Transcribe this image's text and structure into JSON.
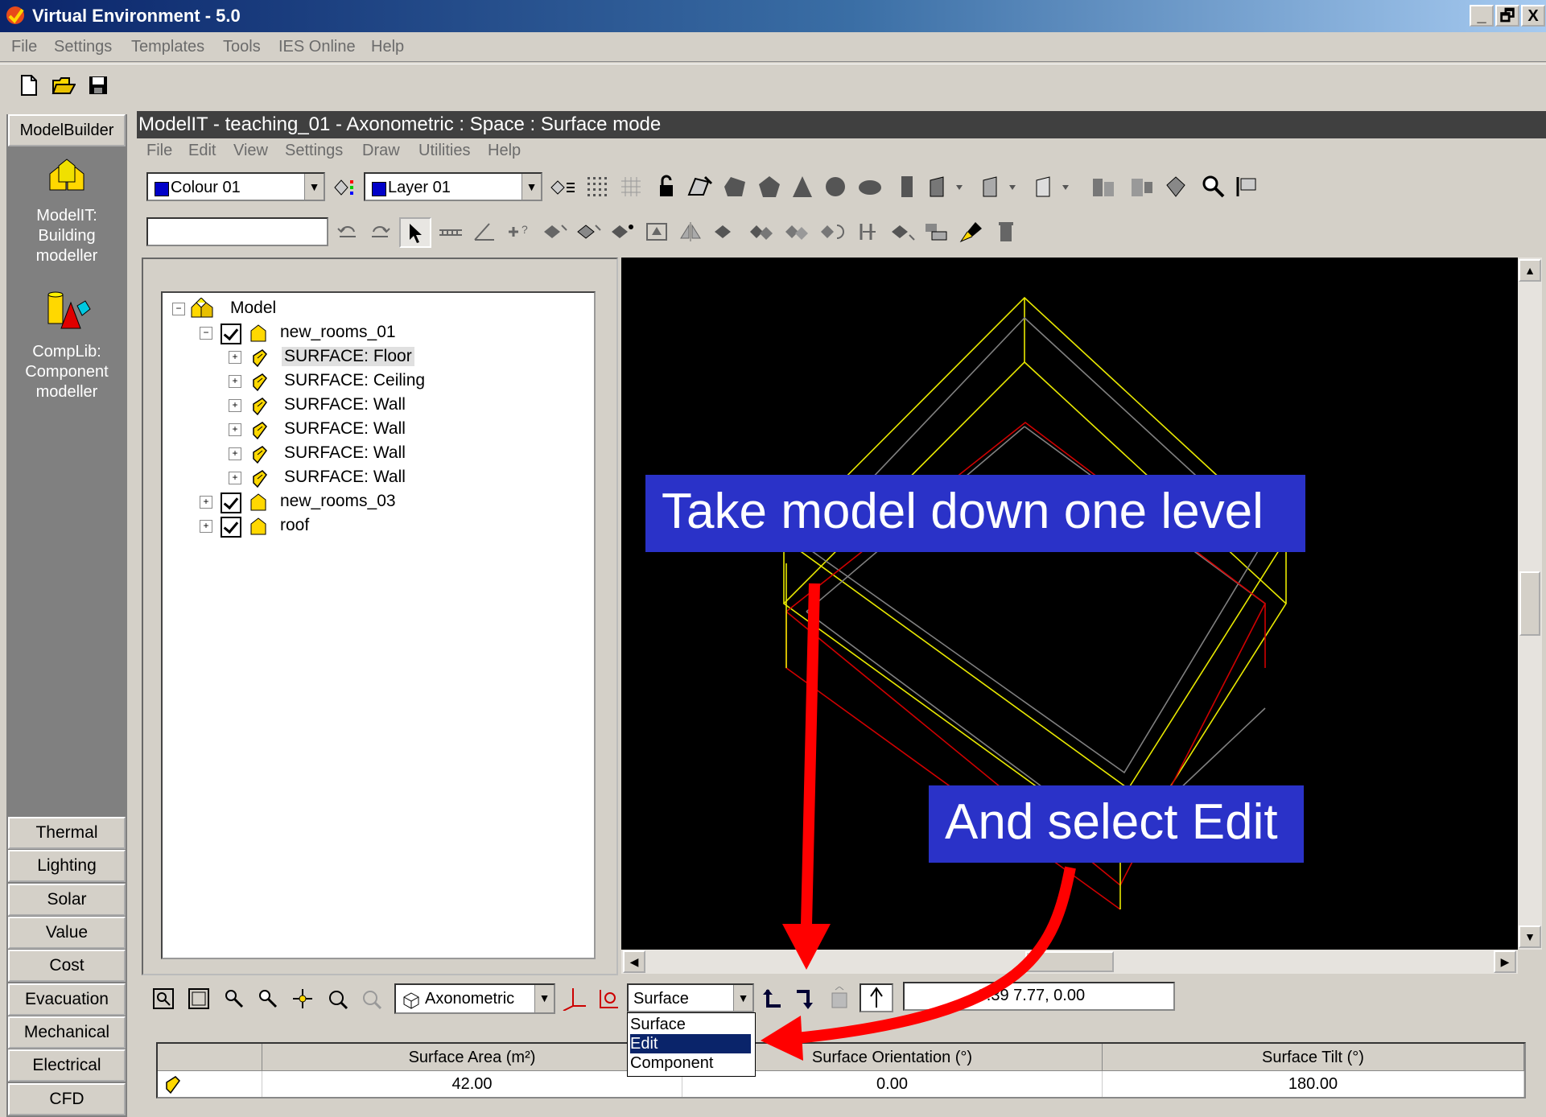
{
  "window": {
    "title": "Virtual Environment - 5.0",
    "btn_min": "_",
    "btn_max": "🗗",
    "btn_close": "X"
  },
  "menubar": [
    "File",
    "Settings",
    "Templates",
    "Tools",
    "IES Online",
    "Help"
  ],
  "left_panel": {
    "top_tab": "ModelBuilder",
    "modules": [
      {
        "label": "ModelIT: Building modeller",
        "line1": "ModelIT:",
        "line2": "Building",
        "line3": "modeller"
      },
      {
        "label": "CompLib: Component modeller",
        "line1": "CompLib:",
        "line2": "Component",
        "line3": "modeller"
      }
    ],
    "buttons": [
      "Thermal",
      "Lighting",
      "Solar",
      "Value",
      "Cost",
      "Evacuation",
      "Mechanical",
      "Electrical",
      "CFD"
    ]
  },
  "mdi": {
    "title": "ModelIT - teaching_01 - Axonometric : Space : Surface mode",
    "menu": [
      "File",
      "Edit",
      "View",
      "Settings",
      "Draw",
      "Utilities",
      "Help"
    ],
    "colour_combo": "Colour 01",
    "layer_combo": "Layer 01",
    "text_field": ""
  },
  "tree": {
    "root": "Model",
    "items": [
      {
        "label": "new_rooms_01",
        "level": 1
      },
      {
        "label": "SURFACE: Floor",
        "level": 2,
        "selected": true
      },
      {
        "label": "SURFACE: Ceiling",
        "level": 2
      },
      {
        "label": "SURFACE: Wall",
        "level": 2
      },
      {
        "label": "SURFACE: Wall",
        "level": 2
      },
      {
        "label": "SURFACE: Wall",
        "level": 2
      },
      {
        "label": "SURFACE: Wall",
        "level": 2
      },
      {
        "label": "new_rooms_03",
        "level": 1
      },
      {
        "label": "roof",
        "level": 1
      }
    ]
  },
  "bottom_toolbar": {
    "view_combo": "Axonometric",
    "mode_combo": "Surface",
    "north": "N",
    "coordinates": "-3.39  7.77,  0.00",
    "dropdown_options": [
      "Surface",
      "Edit",
      "Component"
    ],
    "dropdown_selected": "Edit"
  },
  "table": {
    "columns": [
      "",
      "Surface Area (m²)",
      "Surface Orientation (°)",
      "Surface Tilt (°)"
    ],
    "rows": [
      [
        "",
        "42.00",
        "0.00",
        "180.00"
      ]
    ]
  },
  "callouts": {
    "first": "Take model down one level",
    "second": "And select Edit"
  },
  "colors": {
    "annotation_bg": "#2a32c8",
    "arrow": "#ff0000",
    "title_start": "#0a246a",
    "selection": "#0a246a"
  }
}
